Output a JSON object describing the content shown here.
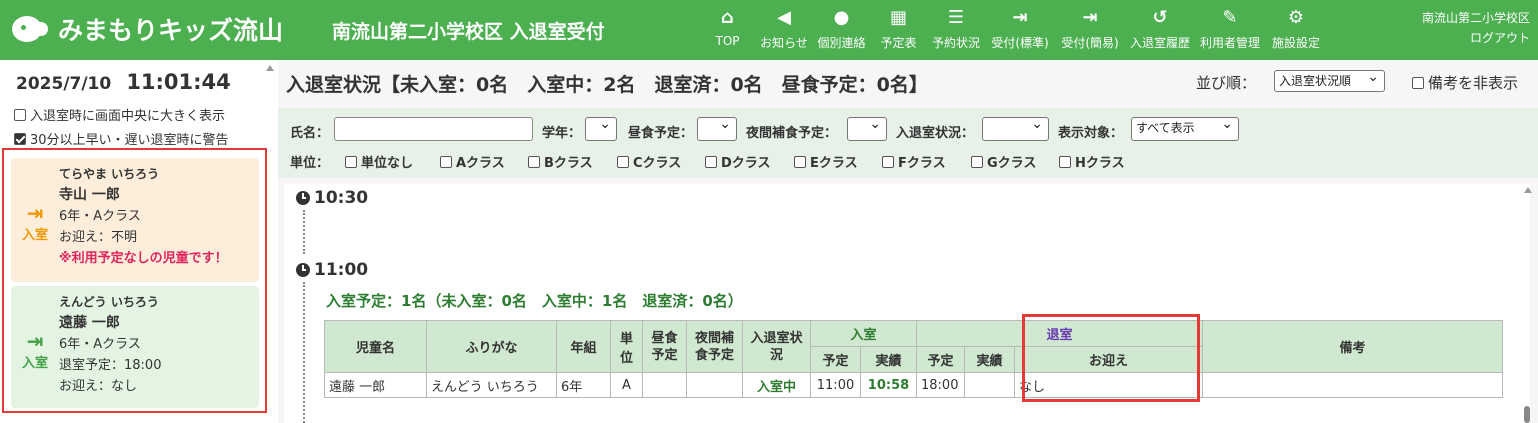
{
  "header": {
    "logo_text": "みまもりキッズ流山",
    "title": "南流山第二小学校区 入退室受付",
    "nav": [
      {
        "label": "TOP",
        "icon": "home-icon",
        "glyph": "⌂"
      },
      {
        "label": "お知らせ",
        "icon": "megaphone-icon",
        "glyph": "📢"
      },
      {
        "label": "個別連絡",
        "icon": "chat-icon",
        "glyph": "💬"
      },
      {
        "label": "予定表",
        "icon": "calendar-icon",
        "glyph": "▦"
      },
      {
        "label": "予約状況",
        "icon": "list-icon",
        "glyph": "☰"
      },
      {
        "label": "受付(標準)",
        "icon": "sign-in-icon",
        "glyph": "⇥"
      },
      {
        "label": "受付(簡易)",
        "icon": "sign-in-icon",
        "glyph": "⇥"
      },
      {
        "label": "入退室履歴",
        "icon": "history-icon",
        "glyph": "↺"
      },
      {
        "label": "利用者管理",
        "icon": "user-edit-icon",
        "glyph": "✎"
      },
      {
        "label": "施設設定",
        "icon": "gear-icon",
        "glyph": "⚙"
      }
    ],
    "facility": "南流山第二小学校区",
    "logout": "ログアウト"
  },
  "sidebar": {
    "date": "2025/7/10",
    "time": "11:01:44",
    "options": [
      {
        "label": "入退室時に画面中央に大きく表示",
        "checked": false
      },
      {
        "label": "30分以上早い・遅い退室時に警告",
        "checked": true
      }
    ],
    "cards": [
      {
        "badge": "入室",
        "kana": "てらやま いちろう",
        "name": "寺山 一郎",
        "class": "6年・Aクラス",
        "line": "お迎え：不明",
        "warning": "※利用予定なしの児童です！"
      },
      {
        "badge": "入室",
        "kana": "えんどう いちろう",
        "name": "遠藤 一郎",
        "class": "6年・Aクラス",
        "line": "退室予定：18:00",
        "line2": "お迎え：なし"
      }
    ]
  },
  "main": {
    "title": "入退室状況【未入室：0名　入室中：2名　退室済：0名　昼食予定：0名】",
    "sort_label": "並び順：",
    "sort_value": "入退室状況順",
    "hide_notes": "備考を非表示",
    "filters": {
      "name_label": "氏名：",
      "grade_label": "学年：",
      "lunch_label": "昼食予定：",
      "night_label": "夜間補食予定：",
      "status_label": "入退室状況：",
      "display_label": "表示対象：",
      "display_value": "すべて表示",
      "unit_label": "単位：",
      "units": [
        "単位なし",
        "Aクラス",
        "Bクラス",
        "Cクラス",
        "Dクラス",
        "Eクラス",
        "Fクラス",
        "Gクラス",
        "Hクラス"
      ]
    },
    "slots": [
      {
        "time": "10:30"
      },
      {
        "time": "11:00"
      }
    ],
    "summary": "入室予定：1名（未入室：0名　入室中：1名　退室済：0名）",
    "table": {
      "headers": {
        "name": "児童名",
        "kana": "ふりがな",
        "grade": "年組",
        "unit": "単位",
        "lunch": "昼食予定",
        "night": "夜間補食予定",
        "status": "入退室状況",
        "entry": "入室",
        "exit": "退室",
        "planned": "予定",
        "actual": "実績",
        "pickup": "お迎え",
        "notes": "備考"
      },
      "rows": [
        {
          "name": "遠藤 一郎",
          "kana": "えんどう いちろう",
          "grade": "6年",
          "unit": "A",
          "lunch": "",
          "night": "",
          "status": "入室中",
          "in_planned": "11:00",
          "in_actual": "10:58",
          "out_planned": "18:00",
          "out_actual": "",
          "pickup": "なし",
          "notes": ""
        }
      ]
    }
  }
}
